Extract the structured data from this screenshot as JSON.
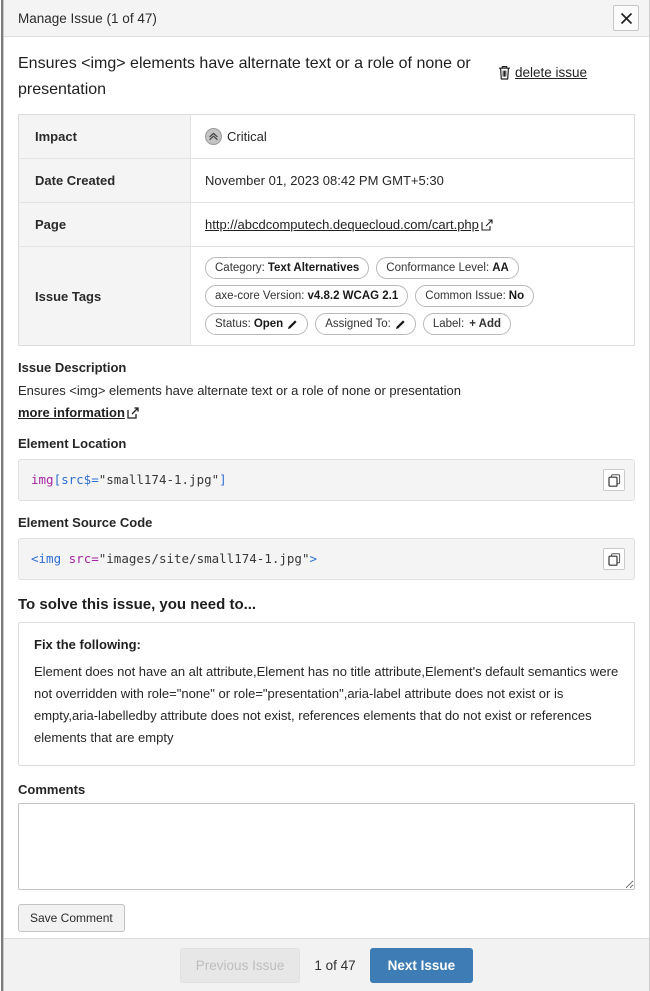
{
  "header": {
    "title": "Manage Issue (1 of 47)",
    "close_icon": "close-icon"
  },
  "issue": {
    "heading": "Ensures <img> elements have alternate text or a role of none or presentation",
    "delete_label": "delete issue",
    "delete_icon": "trash-icon"
  },
  "details": {
    "rows": [
      {
        "label": "Impact",
        "value": "Critical",
        "icon": "critical-chevrons-icon"
      },
      {
        "label": "Date Created",
        "value": "November 01, 2023 08:42 PM GMT+5:30"
      },
      {
        "label": "Page",
        "value": "http://abcdcomputech.dequecloud.com/cart.php",
        "icon": "external-link-icon"
      },
      {
        "label": "Issue Tags"
      }
    ]
  },
  "tags": [
    {
      "name": "Category",
      "label": "Category:",
      "value": "Text Alternatives"
    },
    {
      "name": "Conformance Level",
      "label": "Conformance Level:",
      "value": "AA"
    },
    {
      "name": "axe-core Version",
      "label": "axe-core Version:",
      "value": "v4.8.2 WCAG 2.1"
    },
    {
      "name": "Common Issue",
      "label": "Common Issue:",
      "value": "No"
    },
    {
      "name": "Status",
      "label": "Status:",
      "value": "Open",
      "icon": "pencil-icon"
    },
    {
      "name": "Assigned To",
      "label": "Assigned To:",
      "value": "",
      "icon": "pencil-icon"
    },
    {
      "name": "Label",
      "label": "Label:",
      "value": "",
      "add": "+ Add"
    }
  ],
  "description": {
    "title": "Issue Description",
    "text": "Ensures <img> elements have alternate text or a role of none or presentation",
    "more_info_label": "more information",
    "more_info_icon": "external-link-icon"
  },
  "element_location": {
    "title": "Element Location",
    "code_tag": "img",
    "code_bracket_open": "[",
    "code_attr": "src$=",
    "code_string": "\"small174-1.jpg\"",
    "code_bracket_close": "]",
    "copy_icon": "copy-icon"
  },
  "element_source": {
    "title": "Element Source Code",
    "code_open": "<img ",
    "code_attr": "src=",
    "code_string": "\"images/site/small174-1.jpg\"",
    "code_close": ">",
    "copy_icon": "copy-icon"
  },
  "solve": {
    "title": "To solve this issue, you need to...",
    "fix_label": "Fix the following:",
    "fix_text": "Element does not have an alt attribute,Element has no title attribute,Element's default semantics were not overridden with role=\"none\" or role=\"presentation\",aria-label attribute does not exist or is empty,aria-labelledby attribute does not exist, references elements that do not exist or references elements that are empty"
  },
  "comments": {
    "title": "Comments",
    "value": "",
    "placeholder": "",
    "save_label": "Save Comment"
  },
  "footer": {
    "prev_label": "Previous Issue",
    "count_label": "1 of 47",
    "next_label": "Next Issue"
  },
  "colors": {
    "accent": "#3d7cb4",
    "header_bg": "#f4f4f4",
    "code_tag": "#a626a4",
    "code_attr": "#2f6fd0"
  }
}
